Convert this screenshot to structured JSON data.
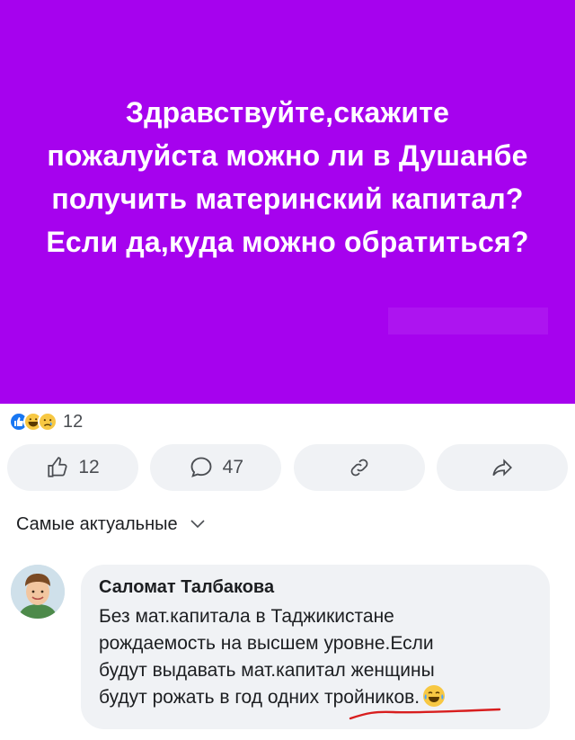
{
  "post": {
    "background": "#a602ee",
    "text_lines": [
      "Здравствуйте,скажите",
      "пожалуйста можно ли в Душанбе",
      "получить материнский капитал?",
      "Если да,куда можно обратиться?"
    ]
  },
  "reactions": {
    "icons": [
      "like-icon",
      "laughing-icon",
      "sad-icon"
    ],
    "count": "12"
  },
  "actions": {
    "like_count": "12",
    "comment_count": "47"
  },
  "comments_sort": {
    "label": "Самые актуальные"
  },
  "comment": {
    "author": "Саломат Талбакова",
    "lines": [
      "Без мат.капитала в Таджикистане",
      "рождаемость на высшем уровне.Если",
      "будут выдавать мат.капитал женщины",
      "будут рожать в год одних тройников."
    ],
    "emoji": "tears-of-joy-icon",
    "underline_color": "#d81e1e"
  }
}
